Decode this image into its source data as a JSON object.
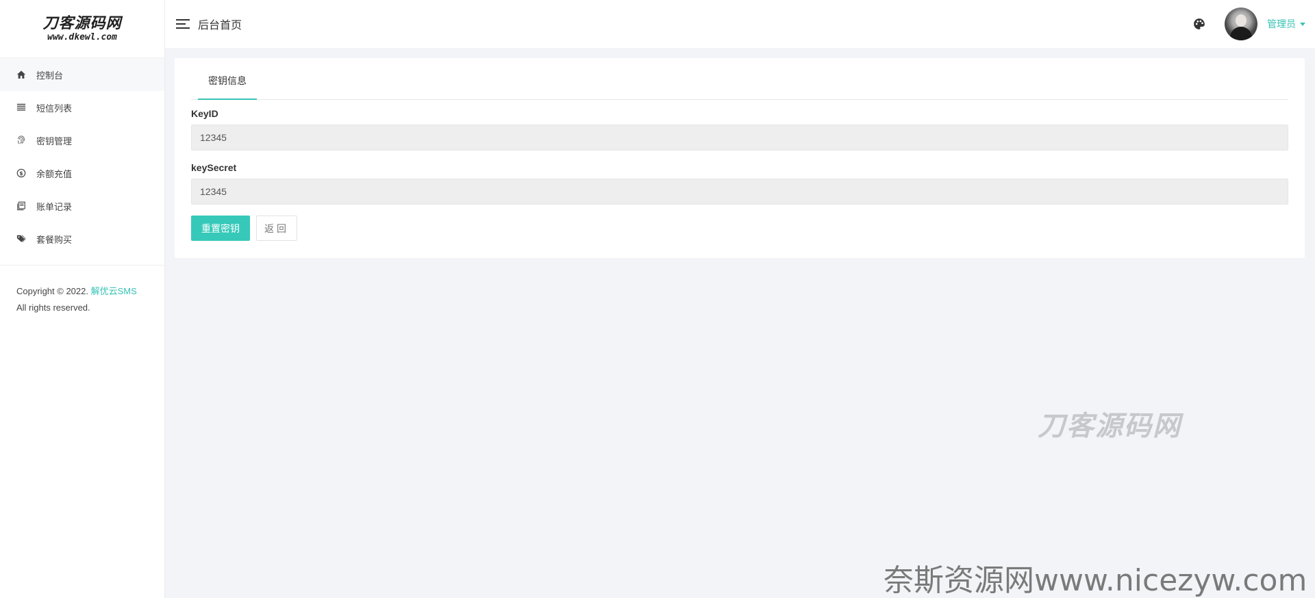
{
  "brand": {
    "logo_main": "刀客源码网",
    "logo_sub": "www.dkewl.com"
  },
  "sidebar": {
    "items": [
      {
        "label": "控制台",
        "icon": "home-icon"
      },
      {
        "label": "短信列表",
        "icon": "list-icon"
      },
      {
        "label": "密钥管理",
        "icon": "fingerprint-icon"
      },
      {
        "label": "余额充值",
        "icon": "dollar-circle-icon"
      },
      {
        "label": "账单记录",
        "icon": "book-icon"
      },
      {
        "label": "套餐购买",
        "icon": "tags-icon"
      }
    ],
    "copyright_prefix": "Copyright © 2022.",
    "copyright_link": "解优云SMS",
    "copyright_suffix": "All rights reserved."
  },
  "header": {
    "title": "后台首页",
    "user_name": "管理员"
  },
  "main": {
    "tab": "密钥信息",
    "key_id_label": "KeyID",
    "key_id_value": "12345",
    "key_secret_label": "keySecret",
    "key_secret_value": "12345",
    "reset_button": "重置密钥",
    "back_button": "返回"
  },
  "watermarks": {
    "center": "刀客源码网",
    "footer": "奈斯资源网www.nicezyw.com"
  },
  "colors": {
    "accent": "#36c3b5",
    "background": "#f3f4f8"
  }
}
